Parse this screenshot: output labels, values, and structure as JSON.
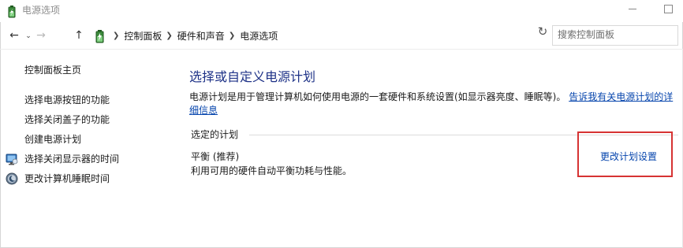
{
  "window": {
    "title": "电源选项",
    "icons": {
      "app": "power-options-battery-icon",
      "minimize": "minimize-icon",
      "maximize": "maximize-icon"
    }
  },
  "nav": {
    "back": "←",
    "forward": "→",
    "recent": "⌄",
    "up": "↑",
    "breadcrumbs": [
      "控制面板",
      "硬件和声音",
      "电源选项"
    ],
    "dropdown": "⌄",
    "refresh": "↻",
    "search_placeholder": "搜索控制面板"
  },
  "sidebar": {
    "items": [
      {
        "label": "控制面板主页",
        "icon": ""
      },
      {
        "label": "选择电源按钮的功能",
        "icon": ""
      },
      {
        "label": "选择关闭盖子的功能",
        "icon": ""
      },
      {
        "label": "创建电源计划",
        "icon": ""
      },
      {
        "label": "选择关闭显示器的时间",
        "icon": "monitor-icon"
      },
      {
        "label": "更改计算机睡眠时间",
        "icon": "sleep-moon-icon"
      }
    ]
  },
  "main": {
    "title": "选择或自定义电源计划",
    "description": "电源计划是用于管理计算机如何使用电源的一套硬件和系统设置(如显示器亮度、睡眠等)。",
    "description_link": "告诉我有关电源计划的详细信息",
    "group_label": "选定的计划",
    "plan": {
      "name": "平衡 (推荐)",
      "description": "利用可用的硬件自动平衡功耗与性能。",
      "change_label": "更改计划设置"
    }
  },
  "colors": {
    "title_blue": "#1e3287",
    "link_blue": "#0645ad",
    "highlight_red": "#d63333"
  }
}
